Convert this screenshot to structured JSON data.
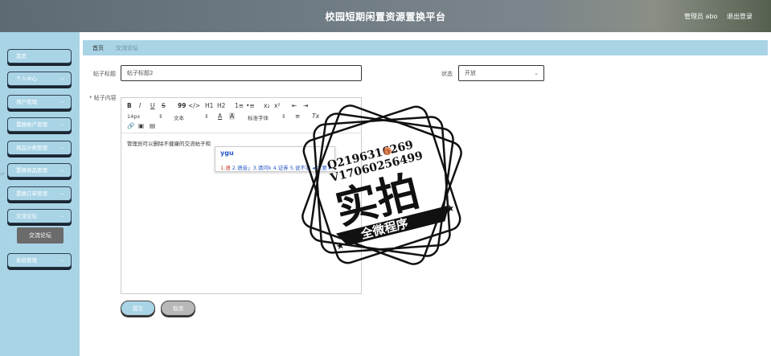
{
  "header": {
    "title": "校园短期闲置资源置换平台",
    "user": "管理员 abo",
    "logout": "退出登录"
  },
  "sidebar": {
    "items": [
      {
        "label": "首页"
      },
      {
        "label": "个人中心"
      },
      {
        "label": "用户管理"
      },
      {
        "label": "置换帐户管理"
      },
      {
        "label": "商品分类管理"
      },
      {
        "label": "置换商品管理"
      },
      {
        "label": "置换订单管理"
      },
      {
        "label": "交流论坛"
      },
      {
        "label": "系统管理"
      }
    ],
    "sub_active": "交流论坛",
    "chevron": "⌄"
  },
  "breadcrumb": {
    "home": "首页",
    "current": "交流论坛"
  },
  "form": {
    "title_label": "帖子标题",
    "title_value": "帖子标题2",
    "status_label": "状态",
    "status_value": "开放",
    "content_label": "* 帖子内容",
    "content_text": "管理员可以删除不健康的交流帖子和",
    "submit": "提交",
    "cancel": "取消"
  },
  "editor_toolbar": {
    "bold": "B",
    "italic": "I",
    "underline": "U",
    "strike": "S",
    "quote": "99",
    "code": "</>",
    "h1": "H1",
    "h2": "H2",
    "ol": "1≡",
    "ul": "•≡",
    "sub": "x₂",
    "sup": "x²",
    "indent_left": "⇤",
    "indent_right": "⇥",
    "size": "14px",
    "text_type": "文本",
    "font": "标准字体",
    "align": "≡",
    "clear": "Tx"
  },
  "ime": {
    "pinyin": "ygu",
    "candidates_first": "1.语",
    "candidates_rest": " 2.语音」3.请问k 4.证券 5.说不准 ◂ 主要 ▸"
  },
  "watermark": {
    "qq": "Q2196316269",
    "v": "V17060256499",
    "main": "实拍",
    "ribbon": "全微程序"
  },
  "colors": {
    "accent": "#a9d4e6",
    "sidebar_sub_active": "#6b6b6b",
    "stamp": "#111111"
  }
}
